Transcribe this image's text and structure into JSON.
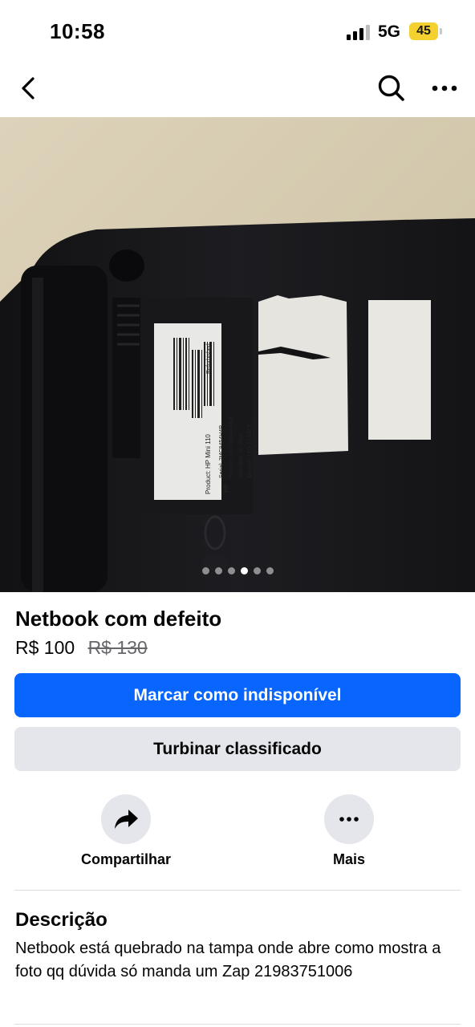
{
  "status_bar": {
    "time": "10:58",
    "network": "5G",
    "battery": "45"
  },
  "nav": {
    "back_icon": "chevron-left-icon",
    "search_icon": "search-icon",
    "more_icon": "more-horizontal-icon"
  },
  "photo": {
    "sticker_text": {
      "brand": "HP",
      "product": "Product:  HP Mini 110",
      "refurbished": "Refurbished",
      "serial": "Serial: 2MC9454H4R",
      "product_code": "Product: VU748AA#ABA",
      "warranty": "Warranty: 90 days",
      "model": "Model:  110-1134CL"
    },
    "carousel": {
      "total": 6,
      "active_index": 3
    }
  },
  "listing": {
    "title": "Netbook com defeito",
    "price": "R$ 100",
    "old_price": "R$ 130"
  },
  "buttons": {
    "mark_unavailable": "Marcar como indisponível",
    "boost": "Turbinar classificado"
  },
  "actions": {
    "share_label": "Compartilhar",
    "more_label": "Mais"
  },
  "description": {
    "heading": "Descrição",
    "text": "Netbook está quebrado na tampa onde abre como mostra a foto qq dúvida só manda um Zap 21983751006"
  },
  "colors": {
    "primary": "#0866ff",
    "secondary_bg": "#e4e6eb",
    "battery": "#f5d130"
  }
}
